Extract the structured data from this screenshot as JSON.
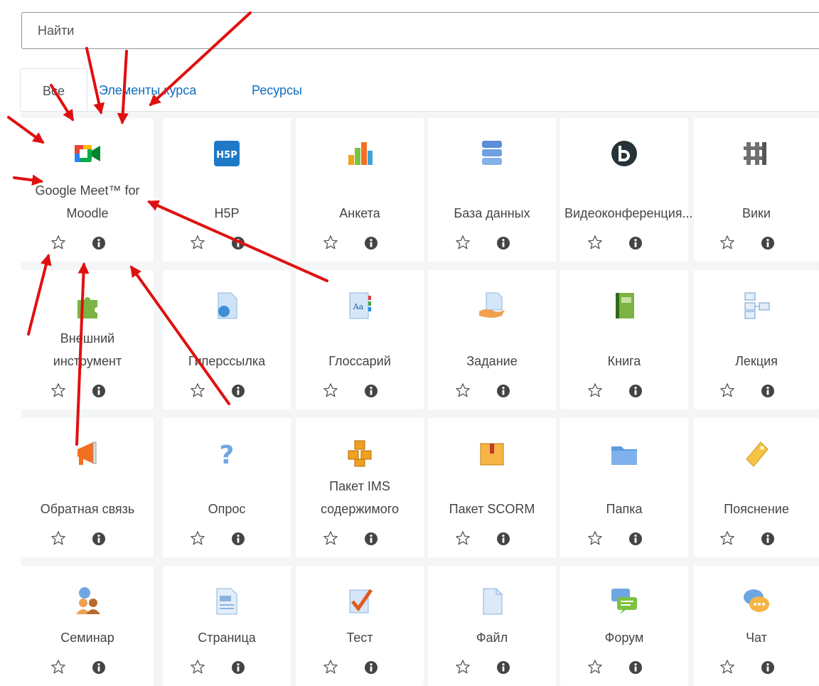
{
  "search": {
    "placeholder": "Найти",
    "value": ""
  },
  "tabs": [
    {
      "label": "Все",
      "active": true
    },
    {
      "label": "Элементы курса",
      "active": false
    },
    {
      "label": "Ресурсы",
      "active": false
    }
  ],
  "modules": [
    {
      "label": "Google Meet™ for Moodle",
      "icon": "google-meet-icon"
    },
    {
      "label": "H5P",
      "icon": "h5p-icon"
    },
    {
      "label": "Анкета",
      "icon": "bar-chart-icon"
    },
    {
      "label": "База данных",
      "icon": "database-icon"
    },
    {
      "label": "Видеоконференция...",
      "icon": "bigbluebutton-icon"
    },
    {
      "label": "Вики",
      "icon": "wiki-icon"
    },
    {
      "label": "Внешний инструмент",
      "icon": "puzzle-icon"
    },
    {
      "label": "Гиперссылка",
      "icon": "url-icon"
    },
    {
      "label": "Глоссарий",
      "icon": "glossary-icon"
    },
    {
      "label": "Задание",
      "icon": "assignment-icon"
    },
    {
      "label": "Книга",
      "icon": "book-icon"
    },
    {
      "label": "Лекция",
      "icon": "lesson-icon"
    },
    {
      "label": "Обратная связь",
      "icon": "megaphone-icon"
    },
    {
      "label": "Опрос",
      "icon": "question-icon"
    },
    {
      "label": "Пакет IMS содержимого",
      "icon": "ims-package-icon"
    },
    {
      "label": "Пакет SCORM",
      "icon": "scorm-package-icon"
    },
    {
      "label": "Папка",
      "icon": "folder-icon"
    },
    {
      "label": "Пояснение",
      "icon": "label-tag-icon"
    },
    {
      "label": "Семинар",
      "icon": "workshop-icon"
    },
    {
      "label": "Страница",
      "icon": "page-icon"
    },
    {
      "label": "Тест",
      "icon": "quiz-icon"
    },
    {
      "label": "Файл",
      "icon": "file-icon"
    },
    {
      "label": "Форум",
      "icon": "forum-icon"
    },
    {
      "label": "Чат",
      "icon": "chat-icon"
    }
  ],
  "colors": {
    "link": "#0f6cbf",
    "annotation_arrow": "#e01010",
    "grid_background": "#f4f5f6"
  }
}
